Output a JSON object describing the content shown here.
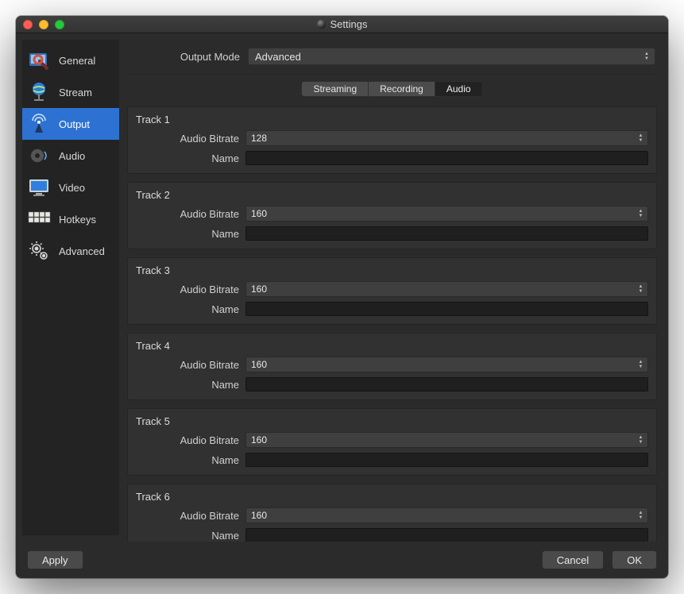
{
  "window": {
    "title": "Settings"
  },
  "sidebar": {
    "items": [
      {
        "label": "General"
      },
      {
        "label": "Stream"
      },
      {
        "label": "Output"
      },
      {
        "label": "Audio"
      },
      {
        "label": "Video"
      },
      {
        "label": "Hotkeys"
      },
      {
        "label": "Advanced"
      }
    ],
    "active_index": 2
  },
  "output_mode": {
    "label": "Output Mode",
    "value": "Advanced"
  },
  "tabs": {
    "items": [
      "Streaming",
      "Recording",
      "Audio"
    ],
    "active_index": 2
  },
  "field_labels": {
    "bitrate": "Audio Bitrate",
    "name": "Name"
  },
  "tracks": [
    {
      "title": "Track 1",
      "bitrate": "128",
      "name": ""
    },
    {
      "title": "Track 2",
      "bitrate": "160",
      "name": ""
    },
    {
      "title": "Track 3",
      "bitrate": "160",
      "name": ""
    },
    {
      "title": "Track 4",
      "bitrate": "160",
      "name": ""
    },
    {
      "title": "Track 5",
      "bitrate": "160",
      "name": ""
    },
    {
      "title": "Track 6",
      "bitrate": "160",
      "name": ""
    }
  ],
  "buttons": {
    "apply": "Apply",
    "cancel": "Cancel",
    "ok": "OK"
  }
}
